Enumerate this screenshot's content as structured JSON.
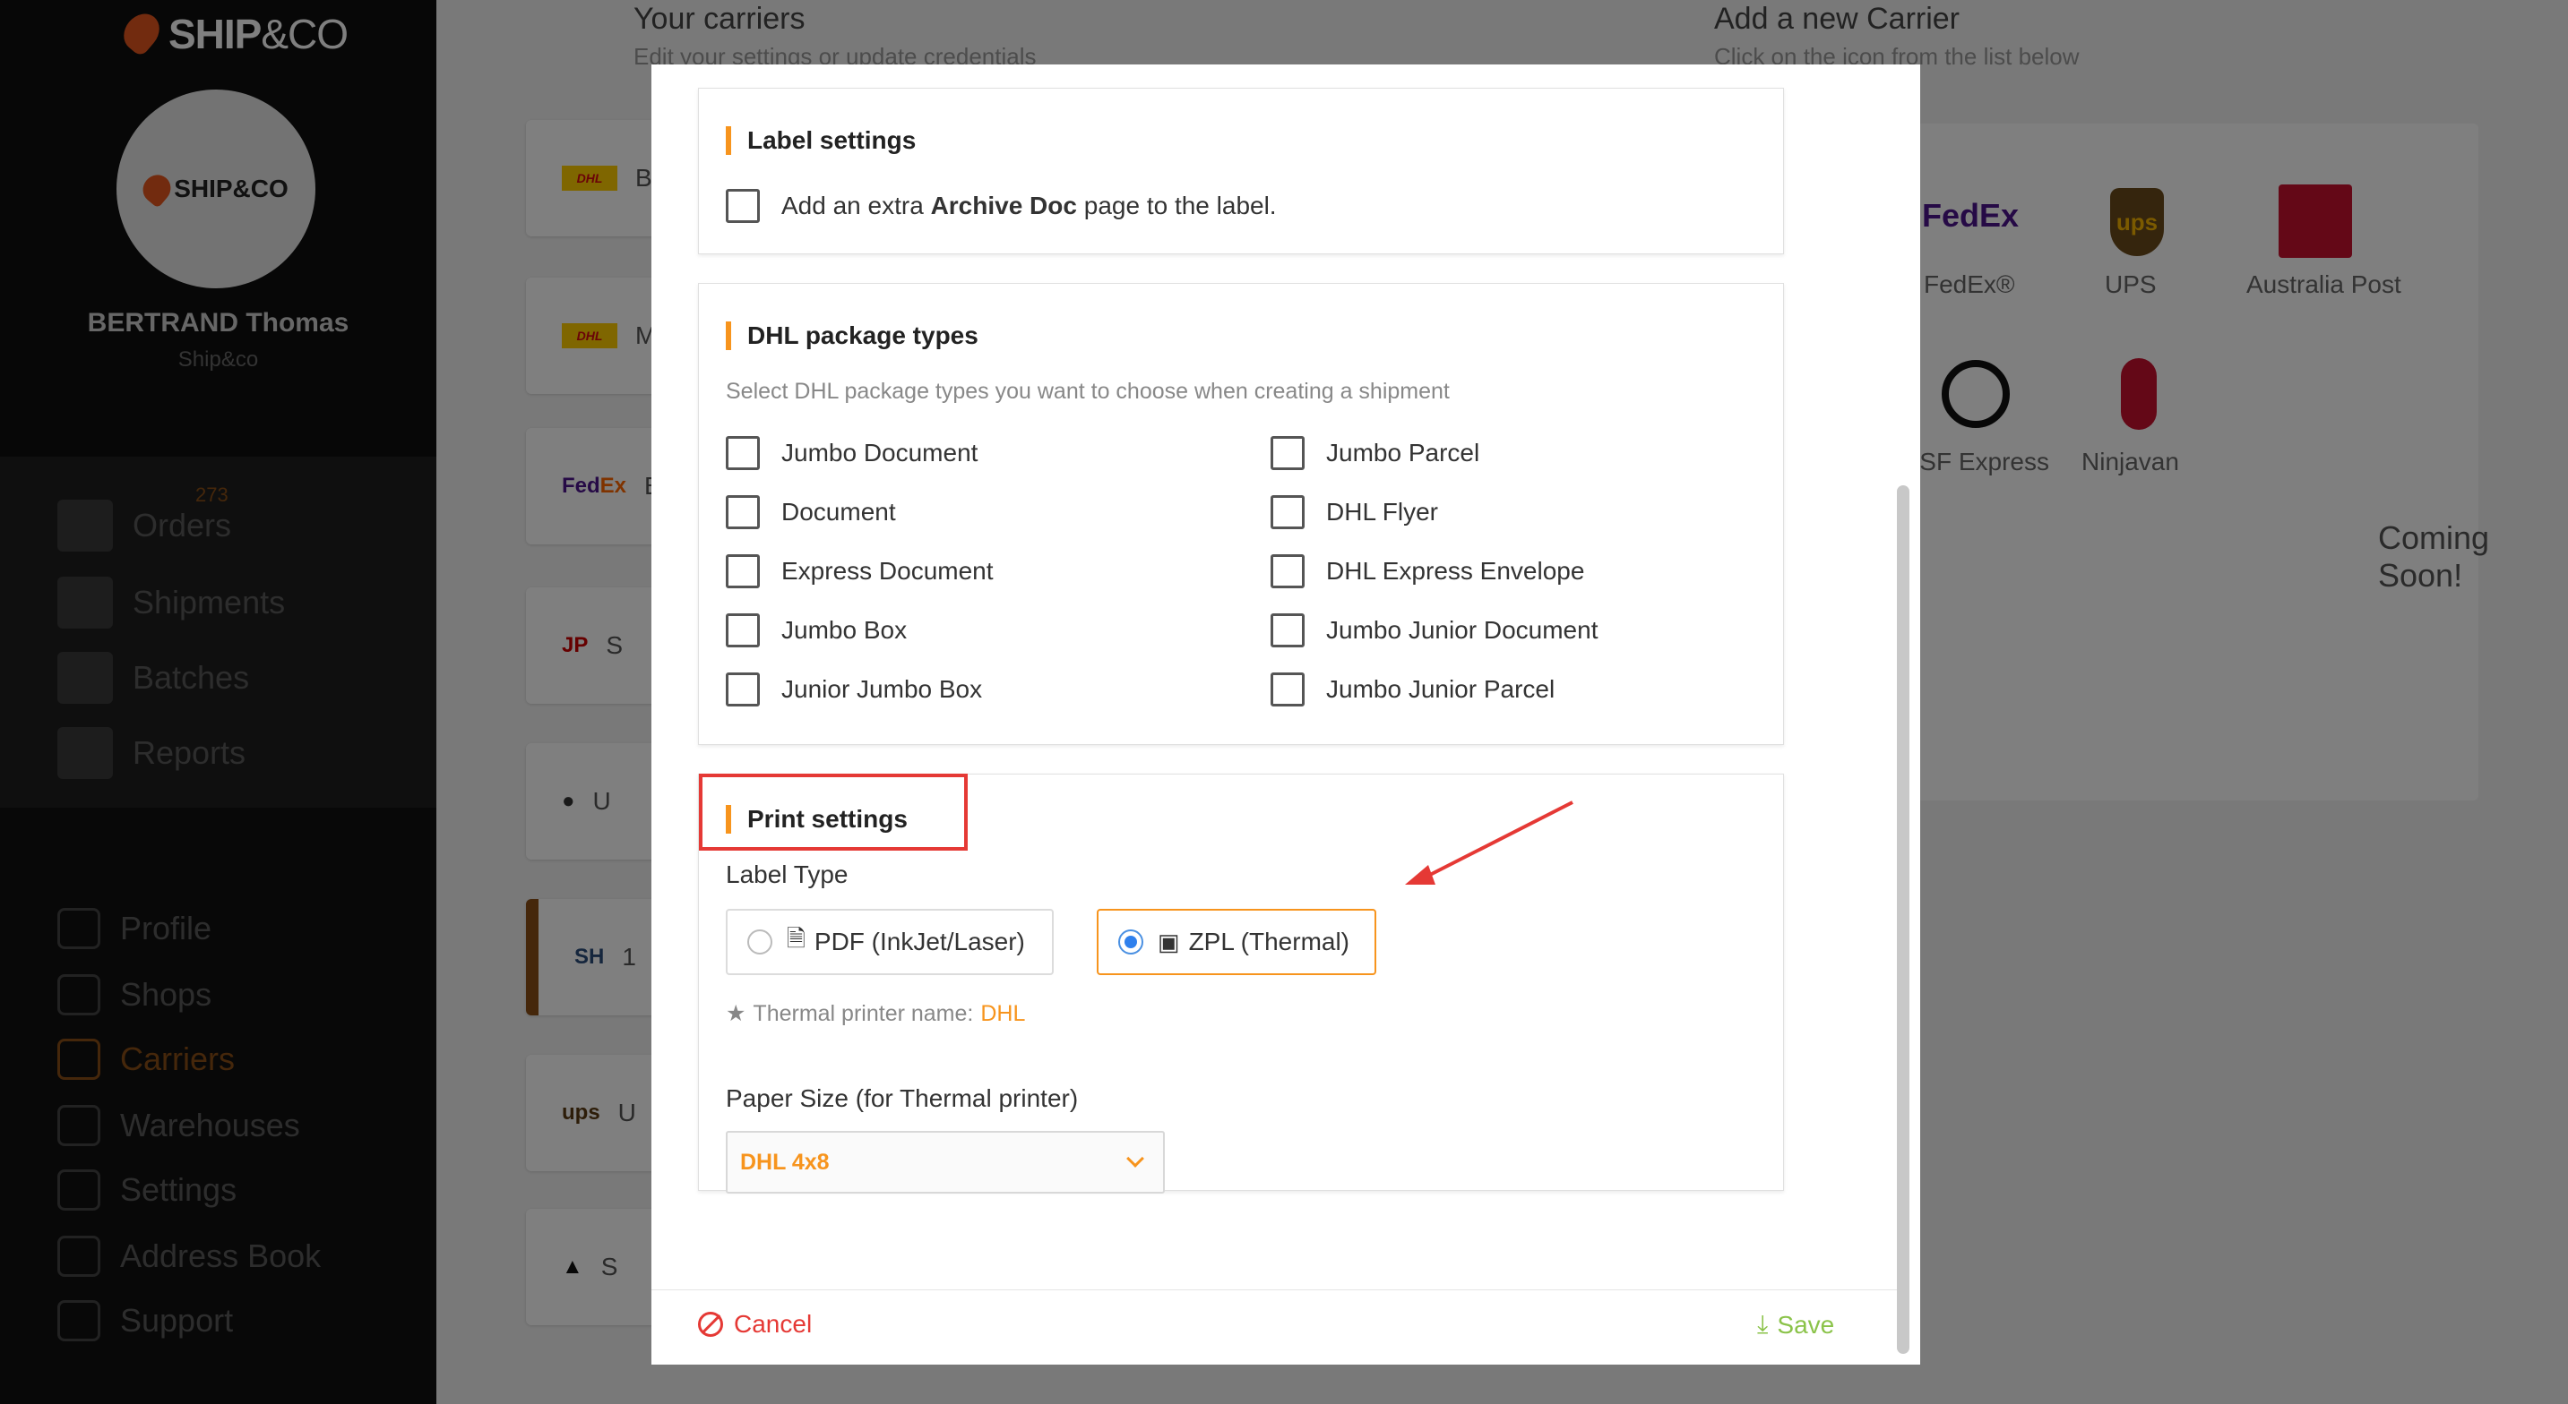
{
  "sidebar": {
    "brand": {
      "main": "SHIP",
      "suffix": "&CO"
    },
    "avatar_brand": "SHIP&CO",
    "user_name": "BERTRAND Thomas",
    "user_org": "Ship&co",
    "orders_count": "273",
    "primary_nav": [
      {
        "label": "Orders",
        "icon": "orders-icon"
      },
      {
        "label": "Shipments",
        "icon": "shipments-icon"
      },
      {
        "label": "Batches",
        "icon": "batches-icon"
      },
      {
        "label": "Reports",
        "icon": "reports-icon"
      }
    ],
    "secondary_nav": [
      {
        "label": "Profile",
        "icon": "profile-icon"
      },
      {
        "label": "Shops",
        "icon": "shops-icon"
      },
      {
        "label": "Carriers",
        "icon": "carriers-icon",
        "active": true
      },
      {
        "label": "Warehouses",
        "icon": "warehouses-icon"
      },
      {
        "label": "Settings",
        "icon": "settings-icon"
      },
      {
        "label": "Address Book",
        "icon": "address-book-icon"
      },
      {
        "label": "Support",
        "icon": "support-icon"
      }
    ]
  },
  "background": {
    "your_carriers_title": "Your carriers",
    "your_carriers_sub": "Edit your settings or update credentials",
    "add_carrier_title": "Add a new Carrier",
    "add_carrier_sub": "Click on the icon from the list below",
    "carrier_cards": [
      "B",
      "M",
      "B",
      "S",
      "U",
      "1",
      "U",
      "S"
    ],
    "available_carriers": [
      "FedEx®",
      "UPS",
      "Australia Post",
      "SF Express",
      "Ninjavan"
    ],
    "available_carrier_logos": [
      "FedEx",
      "ups"
    ],
    "coming_soon": "Coming Soon!"
  },
  "modal": {
    "label_settings": {
      "title": "Label settings",
      "archive_prefix": "Add an extra ",
      "archive_bold": "Archive Doc",
      "archive_suffix": " page to the label."
    },
    "package_types": {
      "title": "DHL package types",
      "description": "Select DHL package types you want to choose when creating a shipment",
      "left": [
        "Jumbo Document",
        "Document",
        "Express Document",
        "Jumbo Box",
        "Junior Jumbo Box"
      ],
      "right": [
        "Jumbo Parcel",
        "DHL Flyer",
        "DHL Express Envelope",
        "Jumbo Junior Document",
        "Jumbo Junior Parcel"
      ]
    },
    "print_settings": {
      "title": "Print settings",
      "label_type": "Label Type",
      "pdf_option": "PDF (InkJet/Laser)",
      "zpl_option": "ZPL (Thermal)",
      "selected": "ZPL (Thermal)",
      "thermal_note_label": "Thermal printer name:",
      "thermal_note_value": "DHL",
      "paper_size_label": "Paper Size (for Thermal printer)",
      "paper_size_value": "DHL 4x8"
    },
    "footer": {
      "cancel": "Cancel",
      "save": "Save"
    }
  },
  "colors": {
    "accent": "#f7941d",
    "danger": "#e53935",
    "success": "#8bc34a",
    "radio_selected": "#2f80ed"
  }
}
